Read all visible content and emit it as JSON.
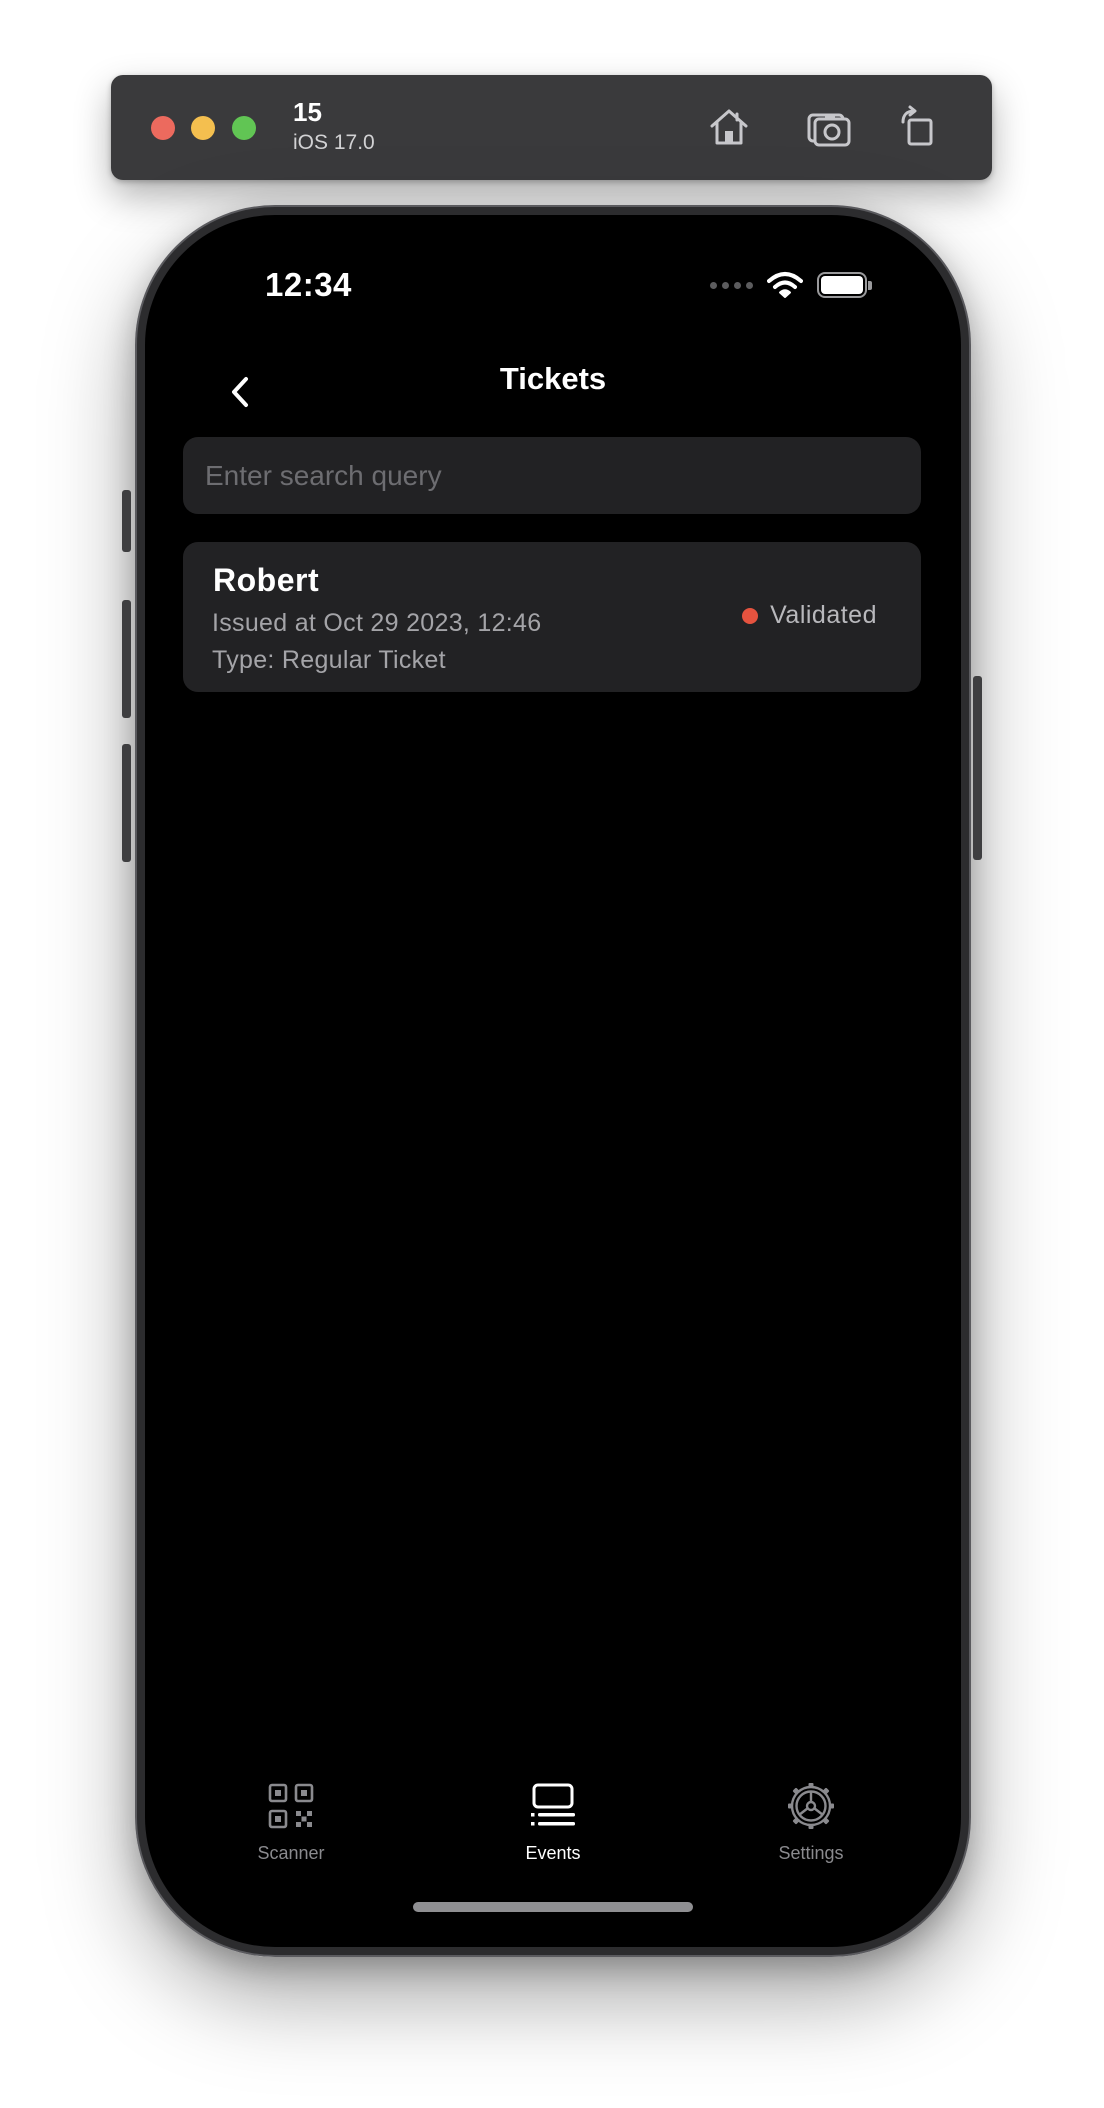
{
  "simulator": {
    "device_name": "15",
    "os_version": "iOS 17.0",
    "buttons": {
      "home_icon": "house-icon",
      "screenshot_icon": "camera-icon",
      "rotate_icon": "rotate-icon"
    }
  },
  "status_bar": {
    "time": "12:34"
  },
  "nav": {
    "title": "Tickets",
    "back_icon": "chevron-left-icon"
  },
  "search": {
    "placeholder": "Enter search query",
    "value": ""
  },
  "tickets": [
    {
      "name": "Robert",
      "issued": "Issued at Oct 29 2023, 12:46",
      "type": "Type: Regular Ticket",
      "status": "Validated",
      "status_color": "#e5533f"
    }
  ],
  "tab_bar": {
    "tabs": [
      {
        "label": "Scanner",
        "icon": "qr-code-icon",
        "active": false
      },
      {
        "label": "Events",
        "icon": "list-icon",
        "active": true
      },
      {
        "label": "Settings",
        "icon": "gear-icon",
        "active": false
      }
    ]
  },
  "colors": {
    "background": "#000000",
    "surface": "#222224",
    "text_primary": "#ffffff",
    "text_secondary": "#a4a4a8",
    "tab_inactive": "#8a8a8e",
    "status_validated": "#e5533f"
  }
}
